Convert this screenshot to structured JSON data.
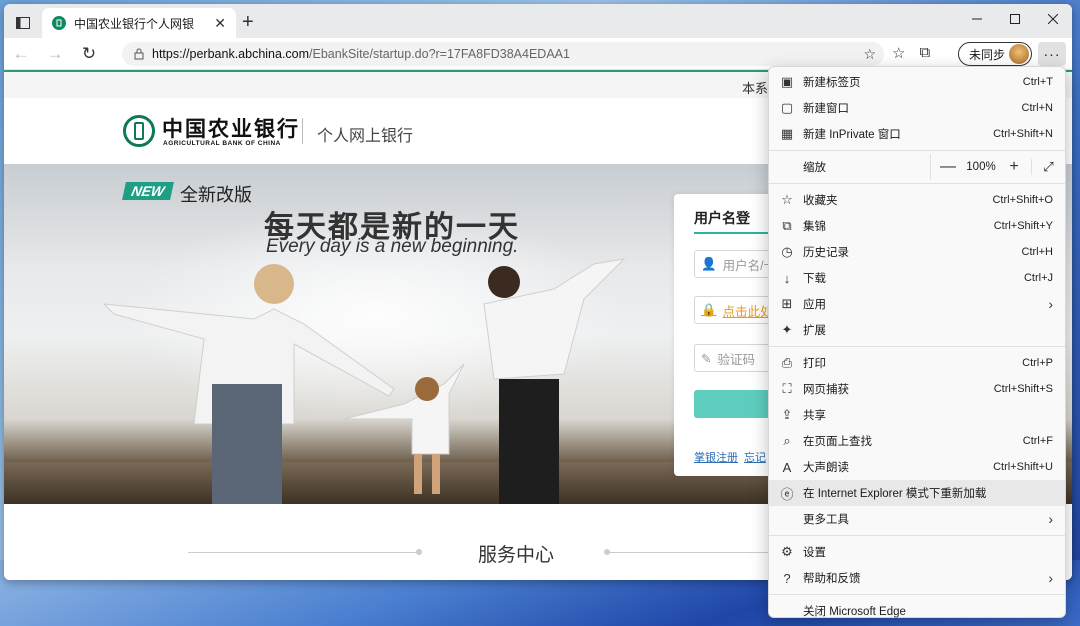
{
  "browser": {
    "tab_title": "中国农业银行个人网银",
    "url_host": "https://perbank.abchina.com",
    "url_path": "/EbankSite/startup.do?r=17FA8FD38A4EDAA1",
    "sync_label": "未同步",
    "more_label": "···",
    "new_tab_symbol": "+",
    "close_symbol": "✕"
  },
  "page": {
    "topstrip_text": "本系",
    "logo_cn": "中国农业银行",
    "logo_en": "AGRICULTURAL BANK OF CHINA",
    "logo_sub": "个人网上银行",
    "new_badge": "NEW",
    "new_text": "全新改版",
    "headline": "每天都是新的一天",
    "headline_en": "Every day is a new beginning.",
    "login": {
      "tab_label": "用户名登",
      "username_placeholder": "用户名/卡",
      "password_link": "点击此处下",
      "captcha_placeholder": "验证码",
      "link_register": "掌银注册",
      "link_forgot": "忘记"
    },
    "service_title": "服务中心"
  },
  "menu": {
    "group1": [
      {
        "icon": "new-tab-icon",
        "label": "新建标签页",
        "shortcut": "Ctrl+T"
      },
      {
        "icon": "new-window-icon",
        "label": "新建窗口",
        "shortcut": "Ctrl+N"
      },
      {
        "icon": "inprivate-icon",
        "label": "新建 InPrivate 窗口",
        "shortcut": "Ctrl+Shift+N"
      }
    ],
    "zoom": {
      "label": "缩放",
      "value": "100%",
      "minus": "—",
      "plus": "+"
    },
    "group2": [
      {
        "icon": "favorites-icon",
        "label": "收藏夹",
        "shortcut": "Ctrl+Shift+O"
      },
      {
        "icon": "collections-icon",
        "label": "集锦",
        "shortcut": "Ctrl+Shift+Y"
      },
      {
        "icon": "history-icon",
        "label": "历史记录",
        "shortcut": "Ctrl+H"
      },
      {
        "icon": "download-icon",
        "label": "下载",
        "shortcut": "Ctrl+J"
      },
      {
        "icon": "apps-icon",
        "label": "应用",
        "shortcut": "",
        "arrow": true
      },
      {
        "icon": "extensions-icon",
        "label": "扩展",
        "shortcut": ""
      }
    ],
    "group3": [
      {
        "icon": "print-icon",
        "label": "打印",
        "shortcut": "Ctrl+P"
      },
      {
        "icon": "web-capture-icon",
        "label": "网页捕获",
        "shortcut": "Ctrl+Shift+S"
      },
      {
        "icon": "share-icon",
        "label": "共享",
        "shortcut": ""
      },
      {
        "icon": "find-icon",
        "label": "在页面上查找",
        "shortcut": "Ctrl+F"
      },
      {
        "icon": "read-aloud-icon",
        "label": "大声朗读",
        "shortcut": "Ctrl+Shift+U"
      },
      {
        "icon": "ie-mode-icon",
        "label": "在 Internet Explorer 模式下重新加载",
        "shortcut": "",
        "hover": true
      },
      {
        "icon": "",
        "label": "更多工具",
        "shortcut": "",
        "arrow": true
      }
    ],
    "group4": [
      {
        "icon": "settings-icon",
        "label": "设置",
        "shortcut": ""
      },
      {
        "icon": "help-icon",
        "label": "帮助和反馈",
        "shortcut": "",
        "arrow": true
      }
    ],
    "close_label": "关闭 Microsoft Edge"
  },
  "colors": {
    "brand_green": "#0d7a54",
    "accent_teal": "#5ecdc0",
    "link_orange": "#e89a1c"
  }
}
